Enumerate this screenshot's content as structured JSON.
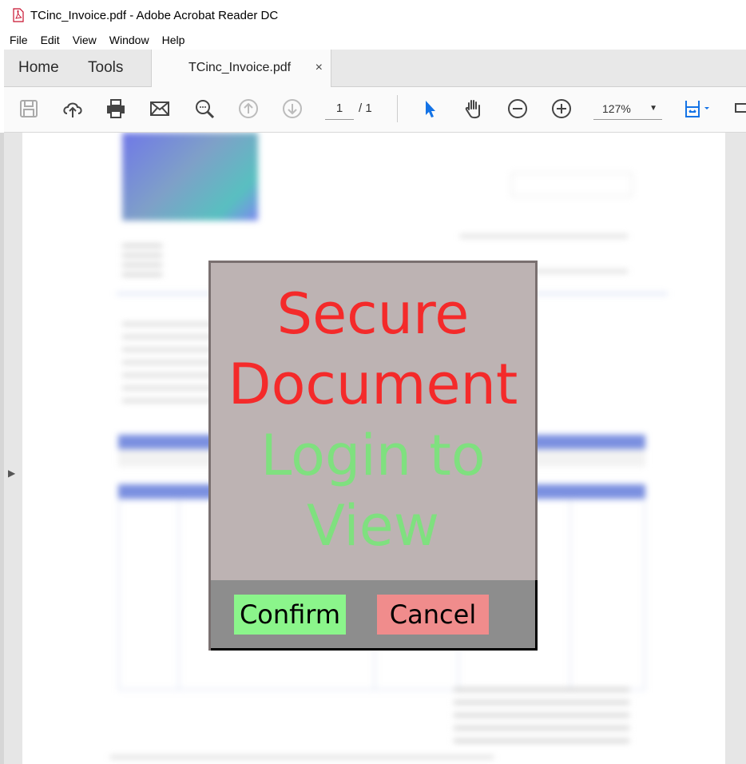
{
  "window": {
    "title": "TCinc_Invoice.pdf - Adobe Acrobat Reader DC"
  },
  "menu": {
    "items": [
      "File",
      "Edit",
      "View",
      "Window",
      "Help"
    ]
  },
  "tabs": {
    "home": "Home",
    "tools": "Tools",
    "document": "TCinc_Invoice.pdf",
    "close": "×"
  },
  "toolbar": {
    "current_page": "1",
    "page_total": "/ 1",
    "zoom": "127%",
    "accent_color": "#1473e6"
  },
  "popup": {
    "title": "Secure Document",
    "subtitle": "Login to View",
    "confirm_label": "Confirm",
    "cancel_label": "Cancel",
    "title_color": "#f42a2a",
    "subtitle_color": "#7fe07f"
  }
}
